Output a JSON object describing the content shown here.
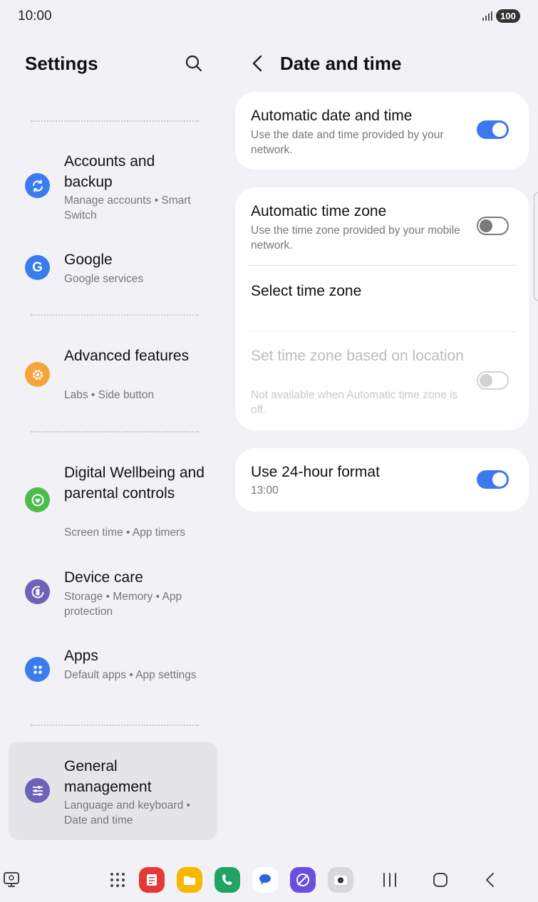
{
  "status": {
    "time": "10:00",
    "battery": "100"
  },
  "left": {
    "title": "Settings",
    "items": [
      {
        "title": "Accounts and backup",
        "subtitle": "Manage accounts  •  Smart Switch",
        "icon": "sync-icon",
        "color": "#3a7bf0"
      },
      {
        "title": "Google",
        "subtitle": "Google services",
        "icon": "google-g-icon",
        "color": "#3a7bf0"
      },
      {
        "title": "Advanced features",
        "subtitle": "Labs  •  Side button",
        "icon": "advanced-gear-icon",
        "color": "#f3a73a"
      },
      {
        "title": "Digital Wellbeing and parental controls",
        "subtitle": "Screen time  •  App timers",
        "icon": "wellbeing-heart-icon",
        "color": "#4cbd4c"
      },
      {
        "title": "Device care",
        "subtitle": "Storage  •  Memory  •  App protection",
        "icon": "device-care-icon",
        "color": "#6c63b8"
      },
      {
        "title": "Apps",
        "subtitle": "Default apps  •  App settings",
        "icon": "apps-grid-icon",
        "color": "#3a7bf0"
      },
      {
        "title": "General management",
        "subtitle": "Language and keyboard  •  Date and time",
        "icon": "sliders-icon",
        "color": "#6c63b8"
      }
    ]
  },
  "right": {
    "title": "Date and time",
    "auto_datetime": {
      "title": "Automatic date and time",
      "subtitle": "Use the date and time provided by your network.",
      "on": true
    },
    "auto_timezone": {
      "title": "Automatic time zone",
      "subtitle": "Use the time zone provided by your mobile network.",
      "on": false
    },
    "select_timezone": {
      "title": "Select time zone"
    },
    "location_timezone": {
      "title": "Set time zone based on location",
      "subtitle": "Not available when Automatic time zone is off.",
      "enabled": false
    },
    "format_24h": {
      "title": "Use 24-hour format",
      "subtitle": "13:00",
      "on": true
    }
  },
  "colors": {
    "accent": "#3e78f0",
    "background": "#f2f1f6",
    "card": "#ffffff"
  },
  "dock": [
    "recent-apps-icon",
    "app-drawer-icon",
    "notes-app-icon",
    "files-app-icon",
    "phone-app-icon",
    "messages-app-icon",
    "internet-app-icon",
    "camera-app-icon"
  ]
}
